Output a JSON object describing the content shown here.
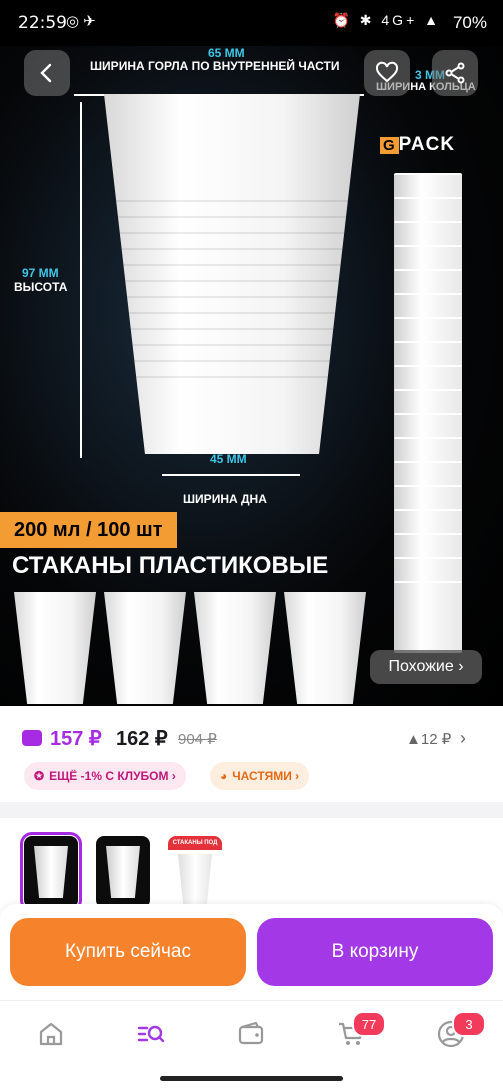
{
  "status_bar": {
    "time": "22:59",
    "battery": "70%",
    "network": "4G+"
  },
  "hero": {
    "neck_width_value": "65 MM",
    "neck_width_label": "ШИРИНА ГОРЛА ПО ВНУТРЕННЕЙ ЧАСТИ",
    "rim_width_value": "3 MM",
    "rim_width_label": "ШИРИНА КОЛЬЦА",
    "height_value": "97 MM",
    "height_label": "ВЫСОТА",
    "bottom_width_value": "45 MM",
    "bottom_width_label": "ШИРИНА ДНА",
    "brand": "PACK",
    "brand_letter": "G",
    "price_badge": "200 мл / 100 шт",
    "title": "СТАКАНЫ ПЛАСТИКОВЫЕ",
    "similar_button": "Похожие ›"
  },
  "price": {
    "club_price": "157 ₽",
    "price": "162 ₽",
    "old_price": "904 ₽",
    "trend": "▲12 ₽",
    "chip_club": "ЕЩЁ -1% С КЛУБОМ ›",
    "chip_parts": "ЧАСТЯМИ ›"
  },
  "thumbnails": {
    "thumb3_caption": "СТАКАНЫ ПОД РАССАДУ"
  },
  "actions": {
    "buy_now": "Купить сейчас",
    "add_to_cart": "В корзину"
  },
  "tabbar": {
    "cart_badge": "77",
    "profile_badge": "3"
  },
  "colors": {
    "accent_purple": "#a238e6",
    "accent_orange": "#f6832c",
    "cyan": "#3fc7e8"
  }
}
